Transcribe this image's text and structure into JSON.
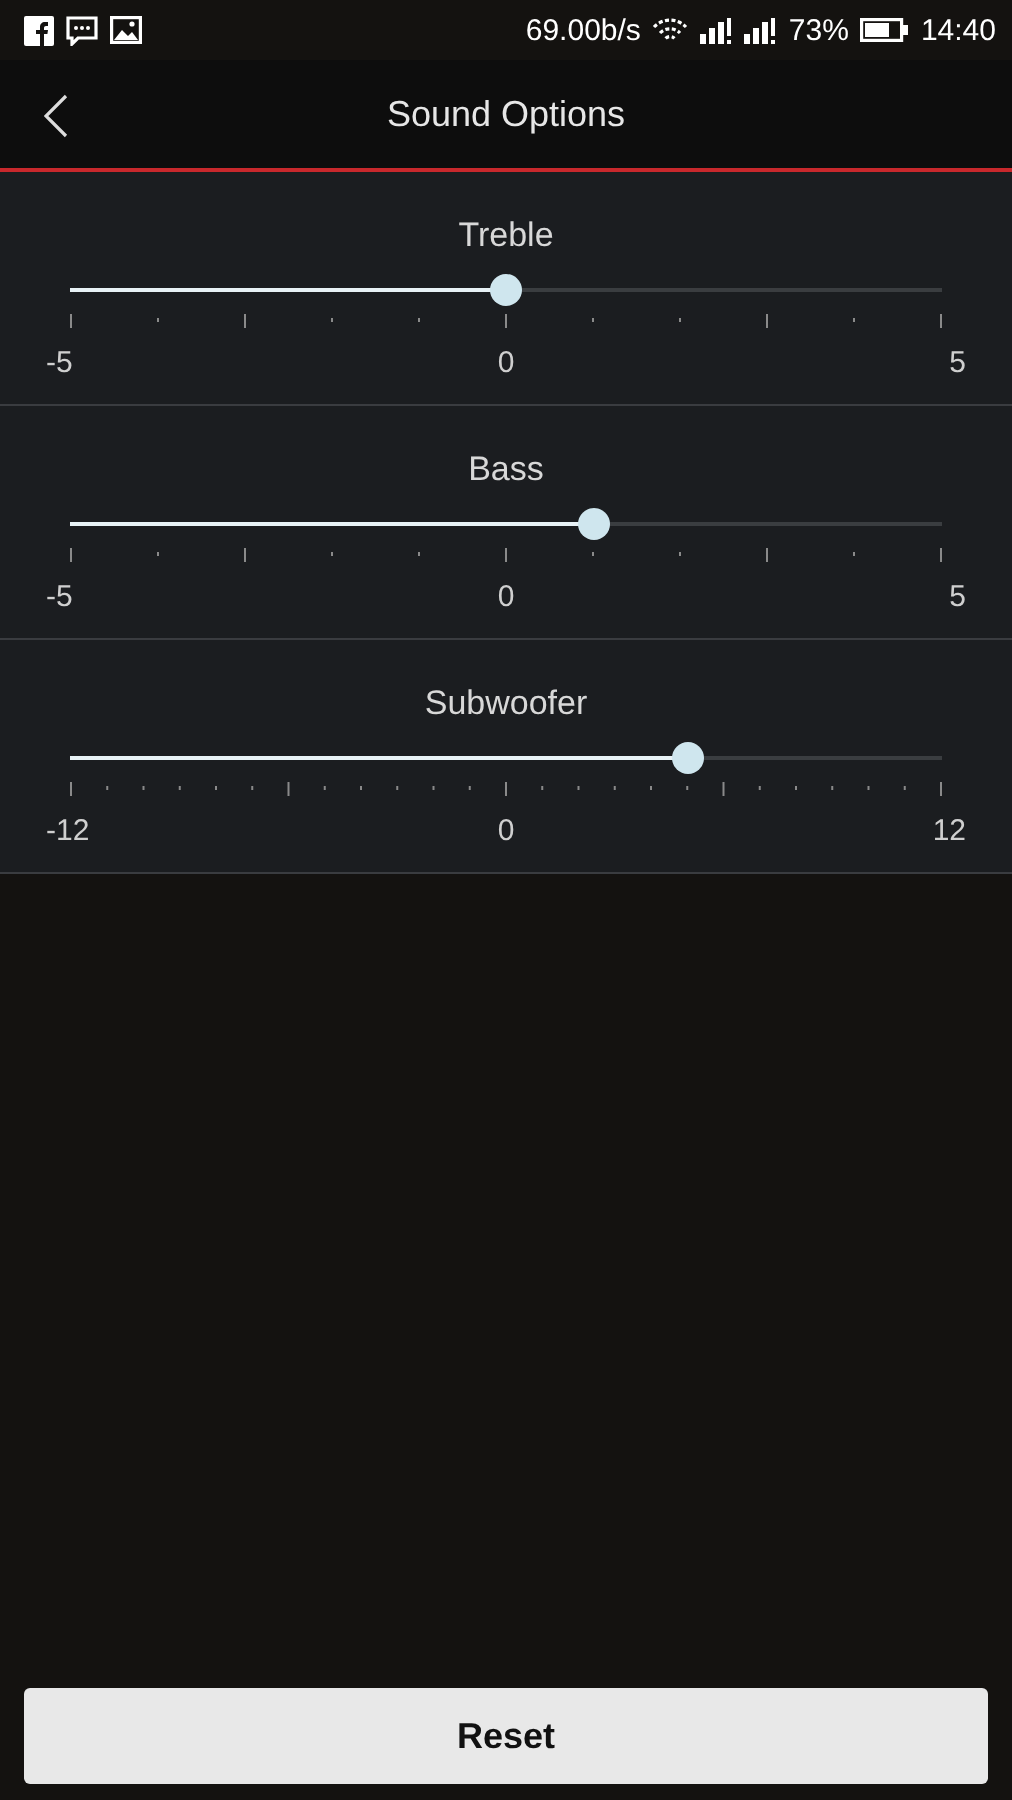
{
  "status_bar": {
    "speed": "69.00b/s",
    "battery": "73%",
    "time": "14:40"
  },
  "header": {
    "title": "Sound Options"
  },
  "sliders": [
    {
      "label": "Treble",
      "kind": "coarse",
      "level": 0.5,
      "min": "-5",
      "mid": "0",
      "max": "5"
    },
    {
      "label": "Bass",
      "kind": "coarse",
      "level": 0.6,
      "min": "-5",
      "mid": "0",
      "max": "5"
    },
    {
      "label": "Subwoofer",
      "kind": "fine",
      "level": 0.708,
      "min": "-12",
      "mid": "0",
      "max": "12"
    }
  ],
  "reset_button": "Reset"
}
